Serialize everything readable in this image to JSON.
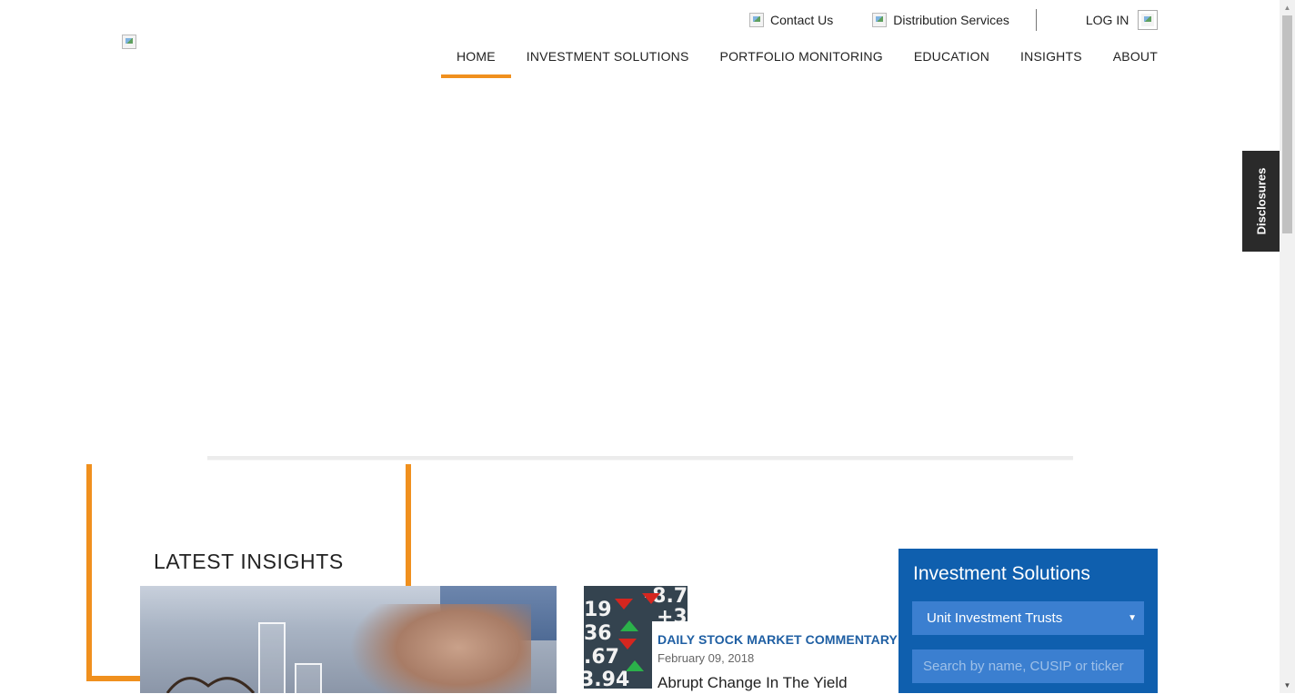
{
  "header": {
    "utility": {
      "contact_label": "Contact Us",
      "distribution_label": "Distribution Services",
      "login_label": "LOG IN"
    },
    "nav": [
      {
        "label": "HOME",
        "active": true
      },
      {
        "label": "INVESTMENT SOLUTIONS",
        "active": false
      },
      {
        "label": "PORTFOLIO MONITORING",
        "active": false
      },
      {
        "label": "EDUCATION",
        "active": false
      },
      {
        "label": "INSIGHTS",
        "active": false
      },
      {
        "label": "ABOUT",
        "active": false
      }
    ]
  },
  "side_tab": {
    "label": "Disclosures"
  },
  "insights": {
    "title": "LATEST INSIGHTS",
    "article": {
      "category": "DAILY STOCK MARKET COMMENTARY",
      "date": "February 09, 2018",
      "title": "Abrupt Change In The Yield"
    },
    "stock_thumbnail": {
      "values": [
        "19",
        "-8.7",
        "36",
        "+3",
        ".67",
        "3.94"
      ]
    }
  },
  "investment_panel": {
    "title": "Investment Solutions",
    "selected_option": "Unit Investment Trusts",
    "search_placeholder": "Search by name, CUSIP or ticker"
  },
  "colors": {
    "accent_orange": "#f0901e",
    "panel_blue": "#0f5fae",
    "field_blue": "#3b7fd0",
    "category_blue": "#1f5fa3",
    "side_tab_bg": "#2a2a2a"
  },
  "icons": {
    "contact": "broken-image-icon",
    "distribution": "broken-image-icon",
    "login": "broken-image-icon",
    "logo": "broken-image-icon"
  }
}
